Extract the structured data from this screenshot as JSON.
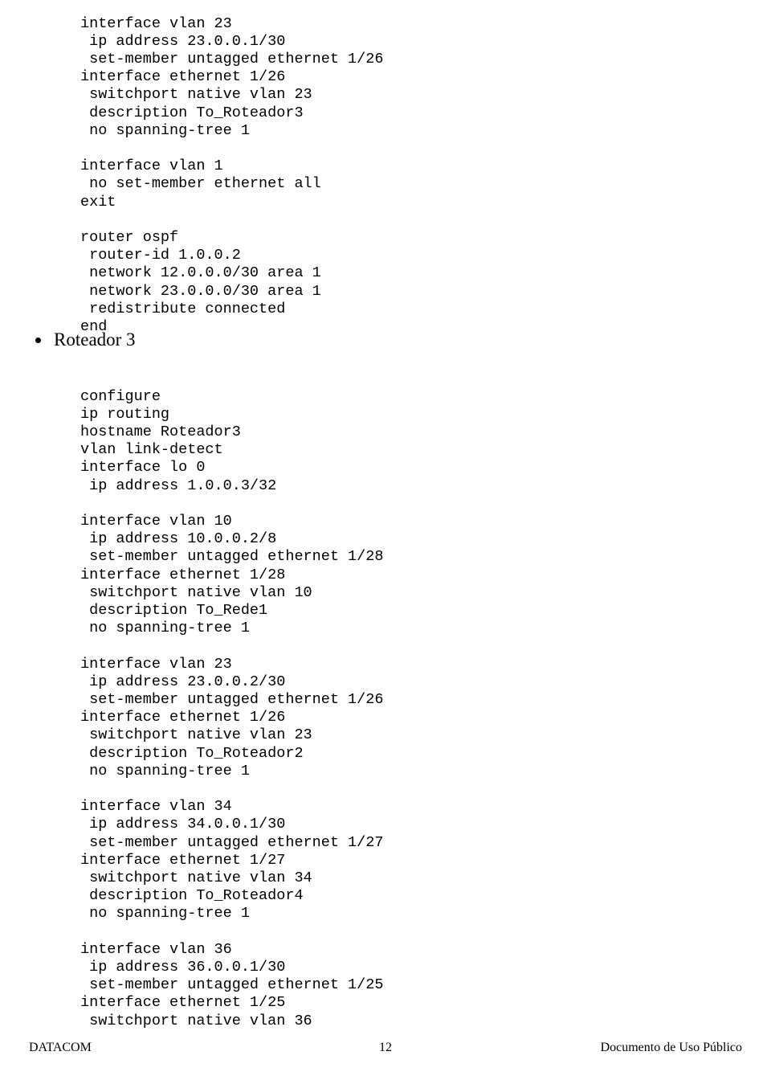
{
  "document": {
    "code_top": "interface vlan 23\n ip address 23.0.0.1/30\n set-member untagged ethernet 1/26\ninterface ethernet 1/26\n switchport native vlan 23\n description To_Roteador3\n no spanning-tree 1\n\ninterface vlan 1\n no set-member ethernet all\nexit\n\nrouter ospf\n router-id 1.0.0.2\n network 12.0.0.0/30 area 1\n network 23.0.0.0/30 area 1\n redistribute connected\nend",
    "section_heading": "Roteador 3",
    "code_bottom": "configure\nip routing\nhostname Roteador3\nvlan link-detect\ninterface lo 0\n ip address 1.0.0.3/32\n\ninterface vlan 10\n ip address 10.0.0.2/8\n set-member untagged ethernet 1/28\ninterface ethernet 1/28\n switchport native vlan 10\n description To_Rede1\n no spanning-tree 1\n\ninterface vlan 23\n ip address 23.0.0.2/30\n set-member untagged ethernet 1/26\ninterface ethernet 1/26\n switchport native vlan 23\n description To_Roteador2\n no spanning-tree 1\n\ninterface vlan 34\n ip address 34.0.0.1/30\n set-member untagged ethernet 1/27\ninterface ethernet 1/27\n switchport native vlan 34\n description To_Roteador4\n no spanning-tree 1\n\ninterface vlan 36\n ip address 36.0.0.1/30\n set-member untagged ethernet 1/25\ninterface ethernet 1/25\n switchport native vlan 36",
    "footer": {
      "left": "DATACOM",
      "page_number": "12",
      "right": "Documento de Uso Público"
    }
  }
}
